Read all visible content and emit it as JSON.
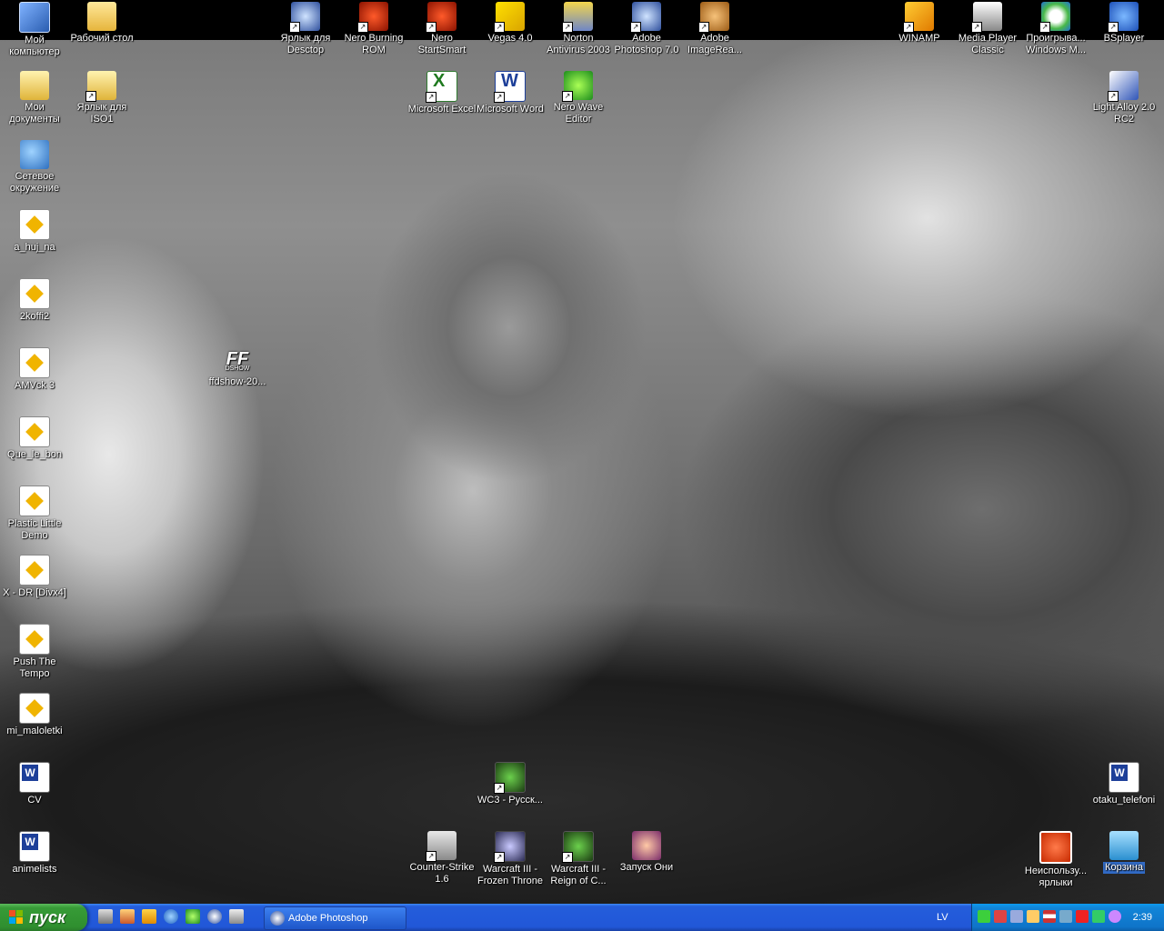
{
  "desktop_icons": {
    "my_computer": "Мой компьютер",
    "desktop": "Рабочий стол",
    "my_docs": "Мои документы",
    "iso_shortcut": "Ярлык для ISO1",
    "network": "Сетевое окружение",
    "a_huj_na": "a_huj_na",
    "koffi2": "2koffi2",
    "amvck3": "AMVck 3",
    "que_le_bon": "Que_le_bon",
    "plastic_little": "Plastic Little Demo",
    "xdr_divx": "X - DR [Divx4]",
    "push_tempo": "Push The Tempo",
    "mi_maloletki": "mi_maloletki",
    "cv": "CV",
    "animelists": "animelists",
    "desctop_shortcut": "Ярлык для Desctop",
    "nero_burning": "Nero Burning ROM",
    "nero_startsmart": "Nero StartSmart",
    "vegas": "Vegas 4.0",
    "norton": "Norton Antivirus 2003",
    "photoshop": "Adobe Photoshop 7.0",
    "imageready": "Adobe ImageRea...",
    "winamp": "WINAMP",
    "mpc": "Media Player Classic",
    "wmp": "Проигрыва... Windows M...",
    "bsplayer": "BSplayer",
    "excel": "Microsoft Excel",
    "word": "Microsoft Word",
    "nero_wave": "Nero Wave Editor",
    "light_alloy": "Light Alloy 2.0 RC2",
    "ffdshow": "ffdshow-20...",
    "ff_glyph": "FF",
    "ff_sub": "DSHOW",
    "wc3_russ": "WC3 - Русск...",
    "counter_strike": "Counter-Strike 1.6",
    "wc3_ft": "Warcraft III - Frozen Throne",
    "wc3_roc": "Warcraft III - Reign of C...",
    "oni": "Запуск Они",
    "unused": "Неиспользу... ярлыки",
    "otaku": "otaku_telefoni",
    "trash": "Корзина"
  },
  "taskbar": {
    "start_label": "пуск",
    "window_button": "Adobe Photoshop",
    "language": "LV",
    "clock": "2:39"
  }
}
